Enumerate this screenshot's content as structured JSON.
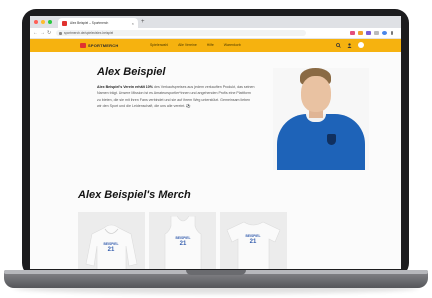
{
  "browser": {
    "tab_title": "Alex Beispiel – Sportmerch",
    "tab_close": "×",
    "new_tab": "+",
    "back": "←",
    "forward": "→",
    "reload": "↻",
    "url": "sportmerch.de/spieler/alex-beispiel"
  },
  "site": {
    "logo_text": "SPORTMERCH",
    "menu": [
      "Spielerwahl",
      "Alle Vereine",
      "Hilfe",
      "Warenkorb"
    ],
    "search_icon": "search-icon",
    "account_icon": "user-icon",
    "cart_icon": "cart-icon"
  },
  "hero": {
    "title": "Alex Beispiel",
    "intro_bold": "Alex Beispiel's Verein erhält 10%",
    "intro_rest": " des Verkaufspreises aus jedem verkauften Produkt, das seinen Namen trägt. Unsere Mission ist es Amateursportler*innen und angehenden Profis eine Plattform zu bieten, die sie mit ihren Fans verbindet und sie auf ihrem Weg unterstützt. Gemeinsam lieben wir den Sport und die Leidenschaft, die uns alle vereint. ⚽"
  },
  "merch": {
    "title": "Alex Beispiel's Merch",
    "items": [
      {
        "type": "hoodie",
        "label": "BEISPIEL",
        "number": "21"
      },
      {
        "type": "tank-top",
        "label": "BEISPIEL",
        "number": "21"
      },
      {
        "type": "t-shirt",
        "label": "BEISPIEL",
        "number": "21"
      }
    ]
  },
  "colors": {
    "header": "#f6b20f",
    "brand_red": "#e0322f",
    "jersey_blue": "#1e63b8",
    "print_blue": "#3a62b0"
  }
}
